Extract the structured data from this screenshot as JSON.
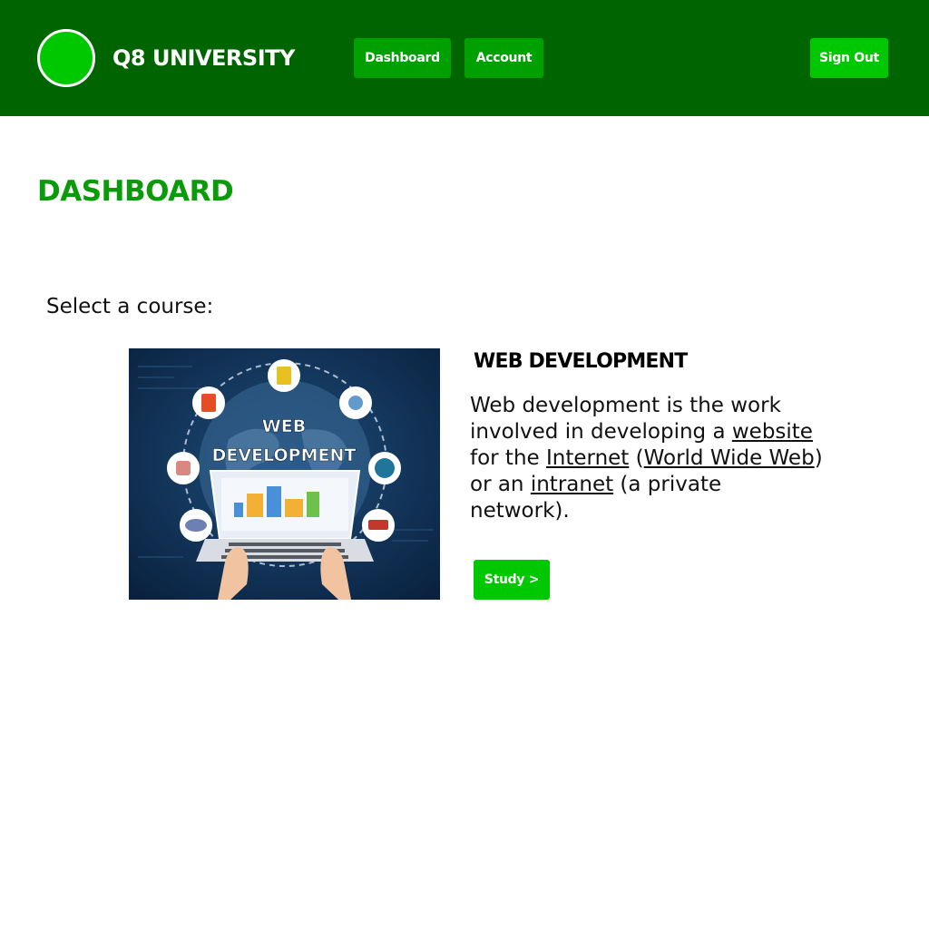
{
  "header": {
    "brand": "Q8 UNIVERSITY",
    "nav": {
      "dashboard": "Dashboard",
      "account": "Account",
      "sign_out": "Sign Out"
    }
  },
  "main": {
    "title": "DASHBOARD",
    "select_label": "Select a course:",
    "course": {
      "title": "WEB DEVELOPMENT",
      "image_text": {
        "line1": "WEB",
        "line2": "DEVELOPMENT"
      },
      "description": {
        "part1": "Web development is the work involved in developing a ",
        "link_website": "website",
        "part2": " for the ",
        "link_internet": "Internet",
        "part3": " (",
        "link_www": "World Wide Web",
        "part4": ") or an ",
        "link_intranet": "intranet",
        "part5": " (a private network)."
      },
      "study_button": "Study >"
    }
  },
  "colors": {
    "header_bg": "#006400",
    "nav_button": "#00a000",
    "accent_button": "#00c800",
    "title_green": "#0a9a0a"
  }
}
